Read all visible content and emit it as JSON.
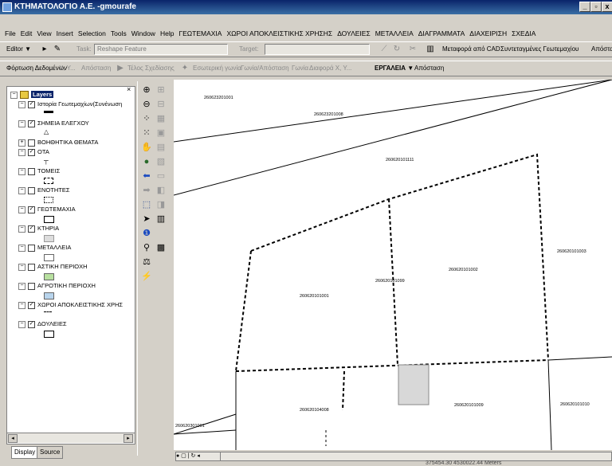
{
  "window": {
    "title": "ΚΤΗΜΑΤΟΛΟΓΙΟ Α.Ε. -gmourafe",
    "min_label": "_",
    "max_label": "▫",
    "close_label": "x"
  },
  "menu": {
    "items": [
      "File",
      "Edit",
      "View",
      "Insert",
      "Selection",
      "Tools",
      "Window",
      "Help",
      "ΓΕΩΤΕΜΑΧΙΑ",
      "ΧΩΡΟΙ ΑΠΟΚΛΕΙΣΤΙΚΗΣ ΧΡΗΣΗΣ",
      "ΔΟΥΛΕΙΕΣ",
      "ΜΕΤΑΛΛΕΙΑ",
      "ΔΙΑΓΡΑΜΜΑΤΑ",
      "ΔΙΑΧΕΙΡΙΣΗ",
      "ΣΧΕΔΙΑ"
    ]
  },
  "editor_toolbar": {
    "editor_label": "Editor ▼",
    "task_label": "Task:",
    "task_value": "Reshape Feature",
    "target_label": "Target:",
    "target_value": "",
    "cad_label": "Μεταφορά από CAD",
    "link_label": "Συντεταγμένες Γεωτεμαχίου",
    "dist_label": "Απόστα"
  },
  "tools_toolbar": {
    "load_label": "Φόρτωση Δεδομένων",
    "xy_label": "X, Y...",
    "dist1_label": "Απόσταση",
    "end_label": "Τέλος Σχεδίασης",
    "angle_label": "Εσωτερική γωνία",
    "angle_dist_label": "Γωνία/Απόσταση",
    "corner_label": "Γωνία",
    "diff_label": "Διαφορά Χ, Υ...",
    "tools_label": "ΕΡΓΑΛΕΙΑ ▼",
    "dist2_label": "Απόσταση"
  },
  "toc": {
    "root_label": "Layers",
    "layers": [
      {
        "label": "Ιστορία Γεωτεμαχίων(Συνένωση",
        "checked": true
      },
      {
        "label": "ΣΗΜΕΙΑ ΕΛΕΓΧΟΥ",
        "checked": true
      },
      {
        "label": "ΒΟΗΘΗΤΙΚΑ ΘΕΜΑΤΑ",
        "checked": false
      },
      {
        "label": "ΟΤΑ",
        "checked": true
      },
      {
        "label": "ΤΟΜΕΙΣ",
        "checked": false
      },
      {
        "label": "ΕΝΟΤΗΤΕΣ",
        "checked": false
      },
      {
        "label": "ΓΕΩΤΕΜΑΧΙΑ",
        "checked": true
      },
      {
        "label": "ΚΤΗΡΙΑ",
        "checked": true
      },
      {
        "label": "ΜΕΤΑΛΛΕΙΑ",
        "checked": false
      },
      {
        "label": "ΑΣΤΙΚΗ ΠΕΡΙΟΧΗ",
        "checked": false
      },
      {
        "label": "ΑΓΡΟΤΙΚΗ ΠΕΡΙΟΧΗ",
        "checked": false
      },
      {
        "label": "ΧΩΡΟΙ ΑΠΟΚΛΕΙΣΤΙΚΗΣ ΧΡΗΣ",
        "checked": true
      },
      {
        "label": "ΔΟΥΛΕΙΕΣ",
        "checked": true
      }
    ],
    "tab_display": "Display",
    "tab_source": "Source"
  },
  "map": {
    "parcels": [
      "260623201001",
      "260623201008",
      "260620101111",
      "260620101002",
      "260620101099",
      "260620101003",
      "260620101001",
      "260620104008",
      "260620101009",
      "260620101010",
      "260620301001"
    ]
  },
  "status": {
    "coords": "375454.30  4530022.44 Meters"
  }
}
